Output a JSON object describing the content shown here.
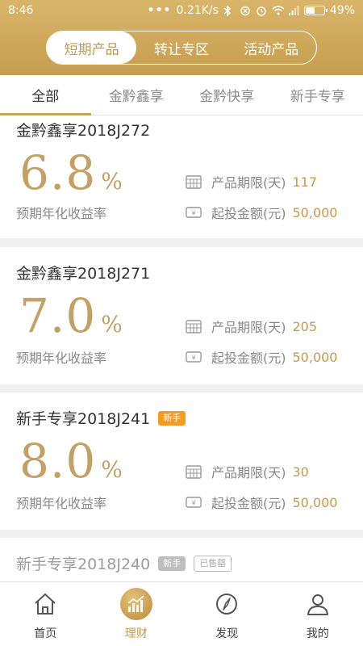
{
  "status": {
    "time": "8:46",
    "dots": "•••",
    "speed": "0.21K/s",
    "battery": "49%"
  },
  "segments": [
    {
      "label": "短期产品",
      "active": true
    },
    {
      "label": "转让专区",
      "active": false
    },
    {
      "label": "活动产品",
      "active": false
    }
  ],
  "tabs": [
    {
      "label": "全部",
      "active": true
    },
    {
      "label": "金黔鑫享",
      "active": false
    },
    {
      "label": "金黔快享",
      "active": false
    },
    {
      "label": "新手专享",
      "active": false
    }
  ],
  "labels": {
    "rate_label": "预期年化收益率",
    "term_label": "产品期限(天)",
    "amount_label": "起投金额(元)",
    "percent": "%"
  },
  "products": [
    {
      "name": "金黔鑫享2018J272",
      "rate": "6.8",
      "term": "117",
      "amount": "50,000",
      "badges": []
    },
    {
      "name": "金黔鑫享2018J271",
      "rate": "7.0",
      "term": "205",
      "amount": "50,000",
      "badges": []
    },
    {
      "name": "新手专享2018J241",
      "rate": "8.0",
      "term": "30",
      "amount": "50,000",
      "badges": [
        "新手"
      ]
    },
    {
      "name": "新手专享2018J240",
      "rate": "",
      "term": "",
      "amount": "",
      "badges": [
        "新手",
        "已售罄"
      ]
    }
  ],
  "bottom_nav": [
    {
      "label": "首页",
      "icon": "home-icon",
      "active": false
    },
    {
      "label": "理财",
      "icon": "finance-chart-icon",
      "active": true
    },
    {
      "label": "发现",
      "icon": "compass-icon",
      "active": false
    },
    {
      "label": "我的",
      "icon": "user-icon",
      "active": false
    }
  ],
  "colors": {
    "gold": "#c9a158",
    "rate_gold": "#c2a066",
    "badge_orange": "#f59a23"
  }
}
